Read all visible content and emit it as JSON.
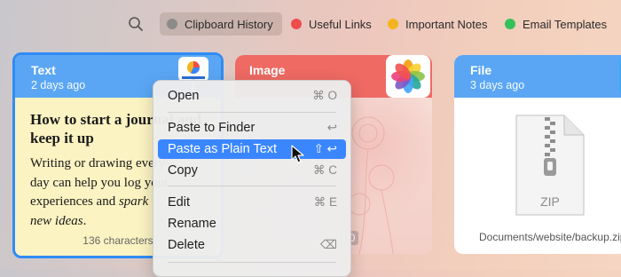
{
  "topbar": {
    "tabs": [
      {
        "label": "Clipboard History",
        "color": "#8b8b8b",
        "active": true
      },
      {
        "label": "Useful Links",
        "color": "#ee4d4d"
      },
      {
        "label": "Important Notes",
        "color": "#f2b51d"
      },
      {
        "label": "Email Templates",
        "color": "#35c15a"
      }
    ]
  },
  "cards": {
    "text": {
      "type": "Text",
      "date": "2 days ago",
      "title": "How to start a journal and keep it up",
      "body_1": "Writing or drawing every",
      "body_2": "day can help you log your",
      "body_3a": "experiences and ",
      "body_3b": "spark",
      "body_4": "new ideas",
      "body_4_end": ".",
      "footer": "136 characters"
    },
    "image": {
      "type": "Image",
      "size": "00"
    },
    "file": {
      "type": "File",
      "date": "3 days ago",
      "ext": "ZIP",
      "path": "Documents/website/backup.zip"
    }
  },
  "menu": {
    "items": [
      {
        "label": "Open",
        "shortcut": "⌘ O"
      },
      {
        "label": "Paste to Finder",
        "shortcut": "↩"
      },
      {
        "label": "Paste as Plain Text",
        "shortcut": "⇧ ↩"
      },
      {
        "label": "Copy",
        "shortcut": "⌘ C"
      },
      {
        "label": "Edit",
        "shortcut": "⌘ E"
      },
      {
        "label": "Rename",
        "shortcut": ""
      },
      {
        "label": "Delete",
        "shortcut": "⌫"
      }
    ]
  }
}
